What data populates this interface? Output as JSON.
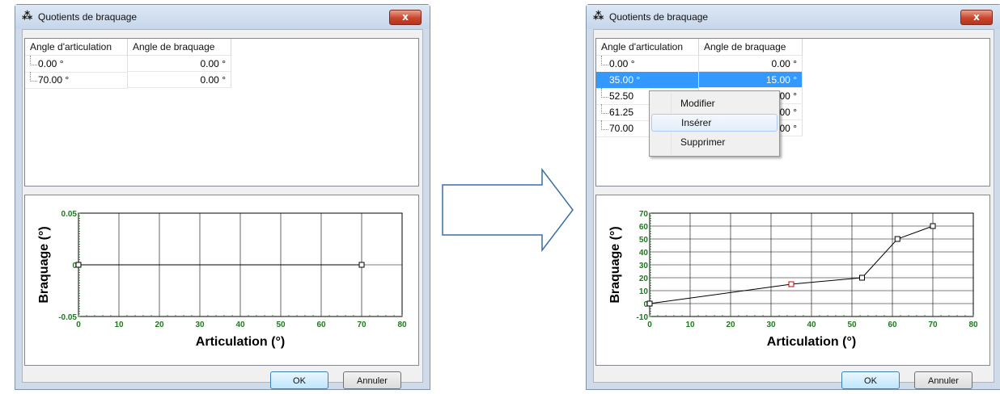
{
  "left_window": {
    "title": "Quotients de braquage",
    "close_label": "x",
    "columns": [
      "Angle d'articulation",
      "Angle de braquage"
    ],
    "rows": [
      {
        "a": "0.00 °",
        "b": "0.00 °"
      },
      {
        "a": "70.00 °",
        "b": "0.00 °"
      }
    ],
    "ok_label": "OK",
    "cancel_label": "Annuler"
  },
  "right_window": {
    "title": "Quotients de braquage",
    "close_label": "x",
    "columns": [
      "Angle d'articulation",
      "Angle de braquage"
    ],
    "rows": [
      {
        "a": "0.00 °",
        "b": "0.00 °"
      },
      {
        "a": "35.00 °",
        "b": "15.00 °"
      },
      {
        "a": "52.50",
        "b": "20.00 °"
      },
      {
        "a": "61.25",
        "b": "50.00 °"
      },
      {
        "a": "70.00",
        "b": "60.00 °"
      }
    ],
    "selected_row": 1,
    "context_menu": [
      "Modifier",
      "Insérer",
      "Supprimer"
    ],
    "context_menu_hover": 1,
    "ok_label": "OK",
    "cancel_label": "Annuler"
  },
  "chart_data": [
    {
      "type": "line",
      "xlabel": "Articulation (°)",
      "ylabel": "Braquage (°)",
      "xlim": [
        0,
        80
      ],
      "ylim": [
        -0.05,
        0.05
      ],
      "x_ticks": [
        "0",
        "10",
        "20",
        "30",
        "40",
        "50",
        "60",
        "70",
        "80"
      ],
      "y_ticks": [
        "-0.05",
        "0",
        "0.05"
      ],
      "grid": true,
      "points": [
        {
          "x": 0,
          "y": 0
        },
        {
          "x": 70,
          "y": 0
        }
      ]
    },
    {
      "type": "line",
      "xlabel": "Articulation (°)",
      "ylabel": "Braquage (°)",
      "xlim": [
        0,
        80
      ],
      "ylim": [
        -10,
        70
      ],
      "x_ticks": [
        "0",
        "10",
        "20",
        "30",
        "40",
        "50",
        "60",
        "70",
        "80"
      ],
      "y_ticks": [
        "-10",
        "0",
        "10",
        "20",
        "30",
        "40",
        "50",
        "60",
        "70"
      ],
      "grid": true,
      "points": [
        {
          "x": 0,
          "y": 0
        },
        {
          "x": 35,
          "y": 15
        },
        {
          "x": 52.5,
          "y": 20
        },
        {
          "x": 61.25,
          "y": 50
        },
        {
          "x": 70,
          "y": 60
        }
      ],
      "highlight_point": 1
    }
  ],
  "colors": {
    "tick_label": "#1a7a1a",
    "selection": "#3399ff",
    "highlight_marker": "#cc0000",
    "arrow_stroke": "#3a6ea5"
  }
}
